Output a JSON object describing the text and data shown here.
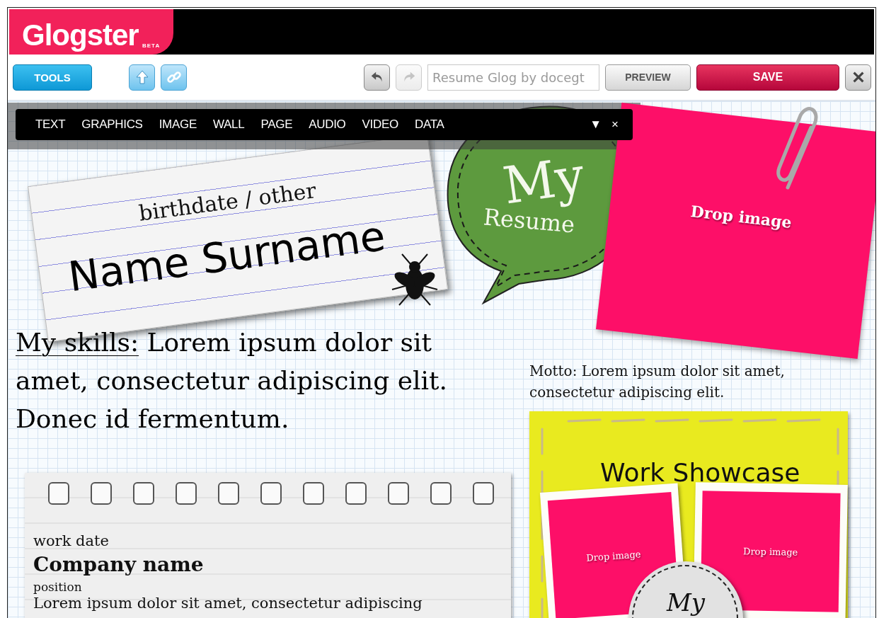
{
  "header": {
    "logo": "Glogster",
    "logo_badge": "BETA"
  },
  "toolbar": {
    "tools_button": "TOOLS",
    "history": [
      {
        "kind": "undo",
        "disabled": false
      },
      {
        "kind": "redo",
        "disabled": true
      }
    ],
    "title_field": {
      "value": "Resume Glog by docegt"
    },
    "preview_button": "PREVIEW",
    "save_button": "SAVE"
  },
  "tools_menu": {
    "items": [
      "TEXT",
      "GRAPHICS",
      "IMAGE",
      "WALL",
      "PAGE",
      "AUDIO",
      "VIDEO",
      "DATA"
    ],
    "collapse": "▼",
    "close": "×"
  },
  "canvas": {
    "name_card": {
      "subtitle": "birthdate / other",
      "name": "Name Surname"
    },
    "bubble": {
      "line_1": "My",
      "line_2": "Resume"
    },
    "sticky_note": {
      "label": "Drop image"
    },
    "skills": {
      "heading": "My skills:",
      "text": "Lorem ipsum dolor sit amet, consectetur adipiscing elit. Donec id fermentum."
    },
    "motto": "Motto: Lorem ipsum dolor sit amet, consectetur adipiscing elit.",
    "showcase": {
      "title": "Work Showcase",
      "photos": [
        {
          "label": "Drop image"
        },
        {
          "label": "Drop image"
        }
      ],
      "badge": "My"
    },
    "work_note": {
      "date": "work date",
      "company": "Company name",
      "position": "position",
      "text": "Lorem ipsum dolor sit amet, consectetur adipiscing"
    }
  }
}
